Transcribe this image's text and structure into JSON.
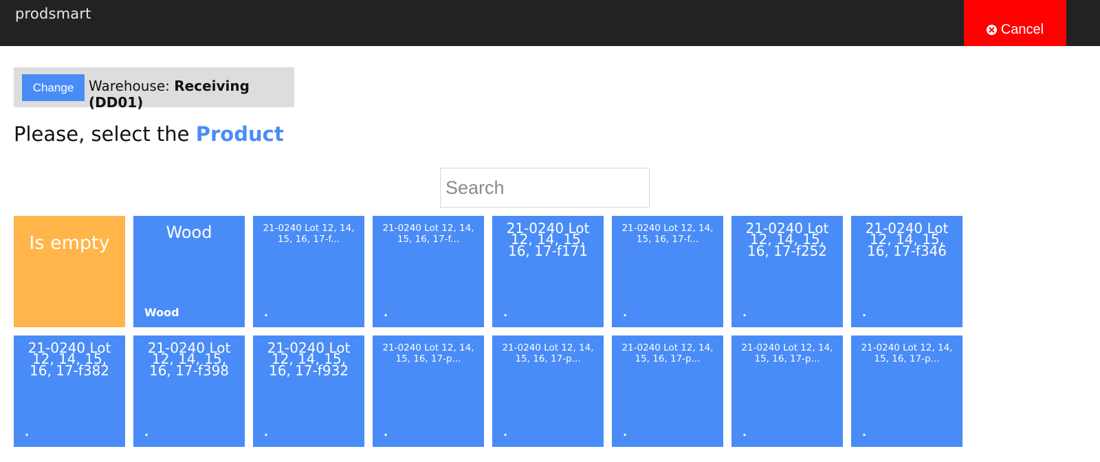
{
  "header": {
    "brand": "prodsmart",
    "cancel_label": "Cancel"
  },
  "warehouse": {
    "change_label": "Change",
    "label": "Warehouse:",
    "name": "Receiving (DD01)"
  },
  "prompt": {
    "prefix": "Please, select the",
    "accent": "Product"
  },
  "search": {
    "placeholder": "Search",
    "value": ""
  },
  "products": [
    {
      "title": "Is empty",
      "sub": ""
    },
    {
      "title": "Wood",
      "sub": "Wood"
    },
    {
      "title": "21-0240 Lot 12, 14, 15, 16, 17-f...",
      "sub": "."
    },
    {
      "title": "21-0240 Lot 12, 14, 15, 16, 17-f...",
      "sub": "."
    },
    {
      "title": "21-0240 Lot 12, 14, 15, 16, 17-f171",
      "sub": "."
    },
    {
      "title": "21-0240 Lot 12, 14, 15, 16, 17-f...",
      "sub": "."
    },
    {
      "title": "21-0240 Lot 12, 14, 15, 16, 17-f252",
      "sub": "."
    },
    {
      "title": "21-0240 Lot 12, 14, 15, 16, 17-f346",
      "sub": "."
    },
    {
      "title": "21-0240 Lot 12, 14, 15, 16, 17-f382",
      "sub": "."
    },
    {
      "title": "21-0240 Lot 12, 14, 15, 16, 17-f398",
      "sub": "."
    },
    {
      "title": "21-0240 Lot 12, 14, 15, 16, 17-f932",
      "sub": "."
    },
    {
      "title": "21-0240 Lot 12, 14, 15, 16, 17-p...",
      "sub": "."
    },
    {
      "title": "21-0240 Lot 12, 14, 15, 16, 17-p...",
      "sub": "."
    },
    {
      "title": "21-0240 Lot 12, 14, 15, 16, 17-p...",
      "sub": "."
    },
    {
      "title": "21-0240 Lot 12, 14, 15, 16, 17-p...",
      "sub": "."
    },
    {
      "title": "21-0240 Lot 12, 14, 15, 16, 17-p...",
      "sub": "."
    }
  ],
  "colors": {
    "topbar": "#222222",
    "cancel": "#ff0000",
    "accent": "#4a8cf7",
    "empty_tile": "#ffb54a"
  }
}
